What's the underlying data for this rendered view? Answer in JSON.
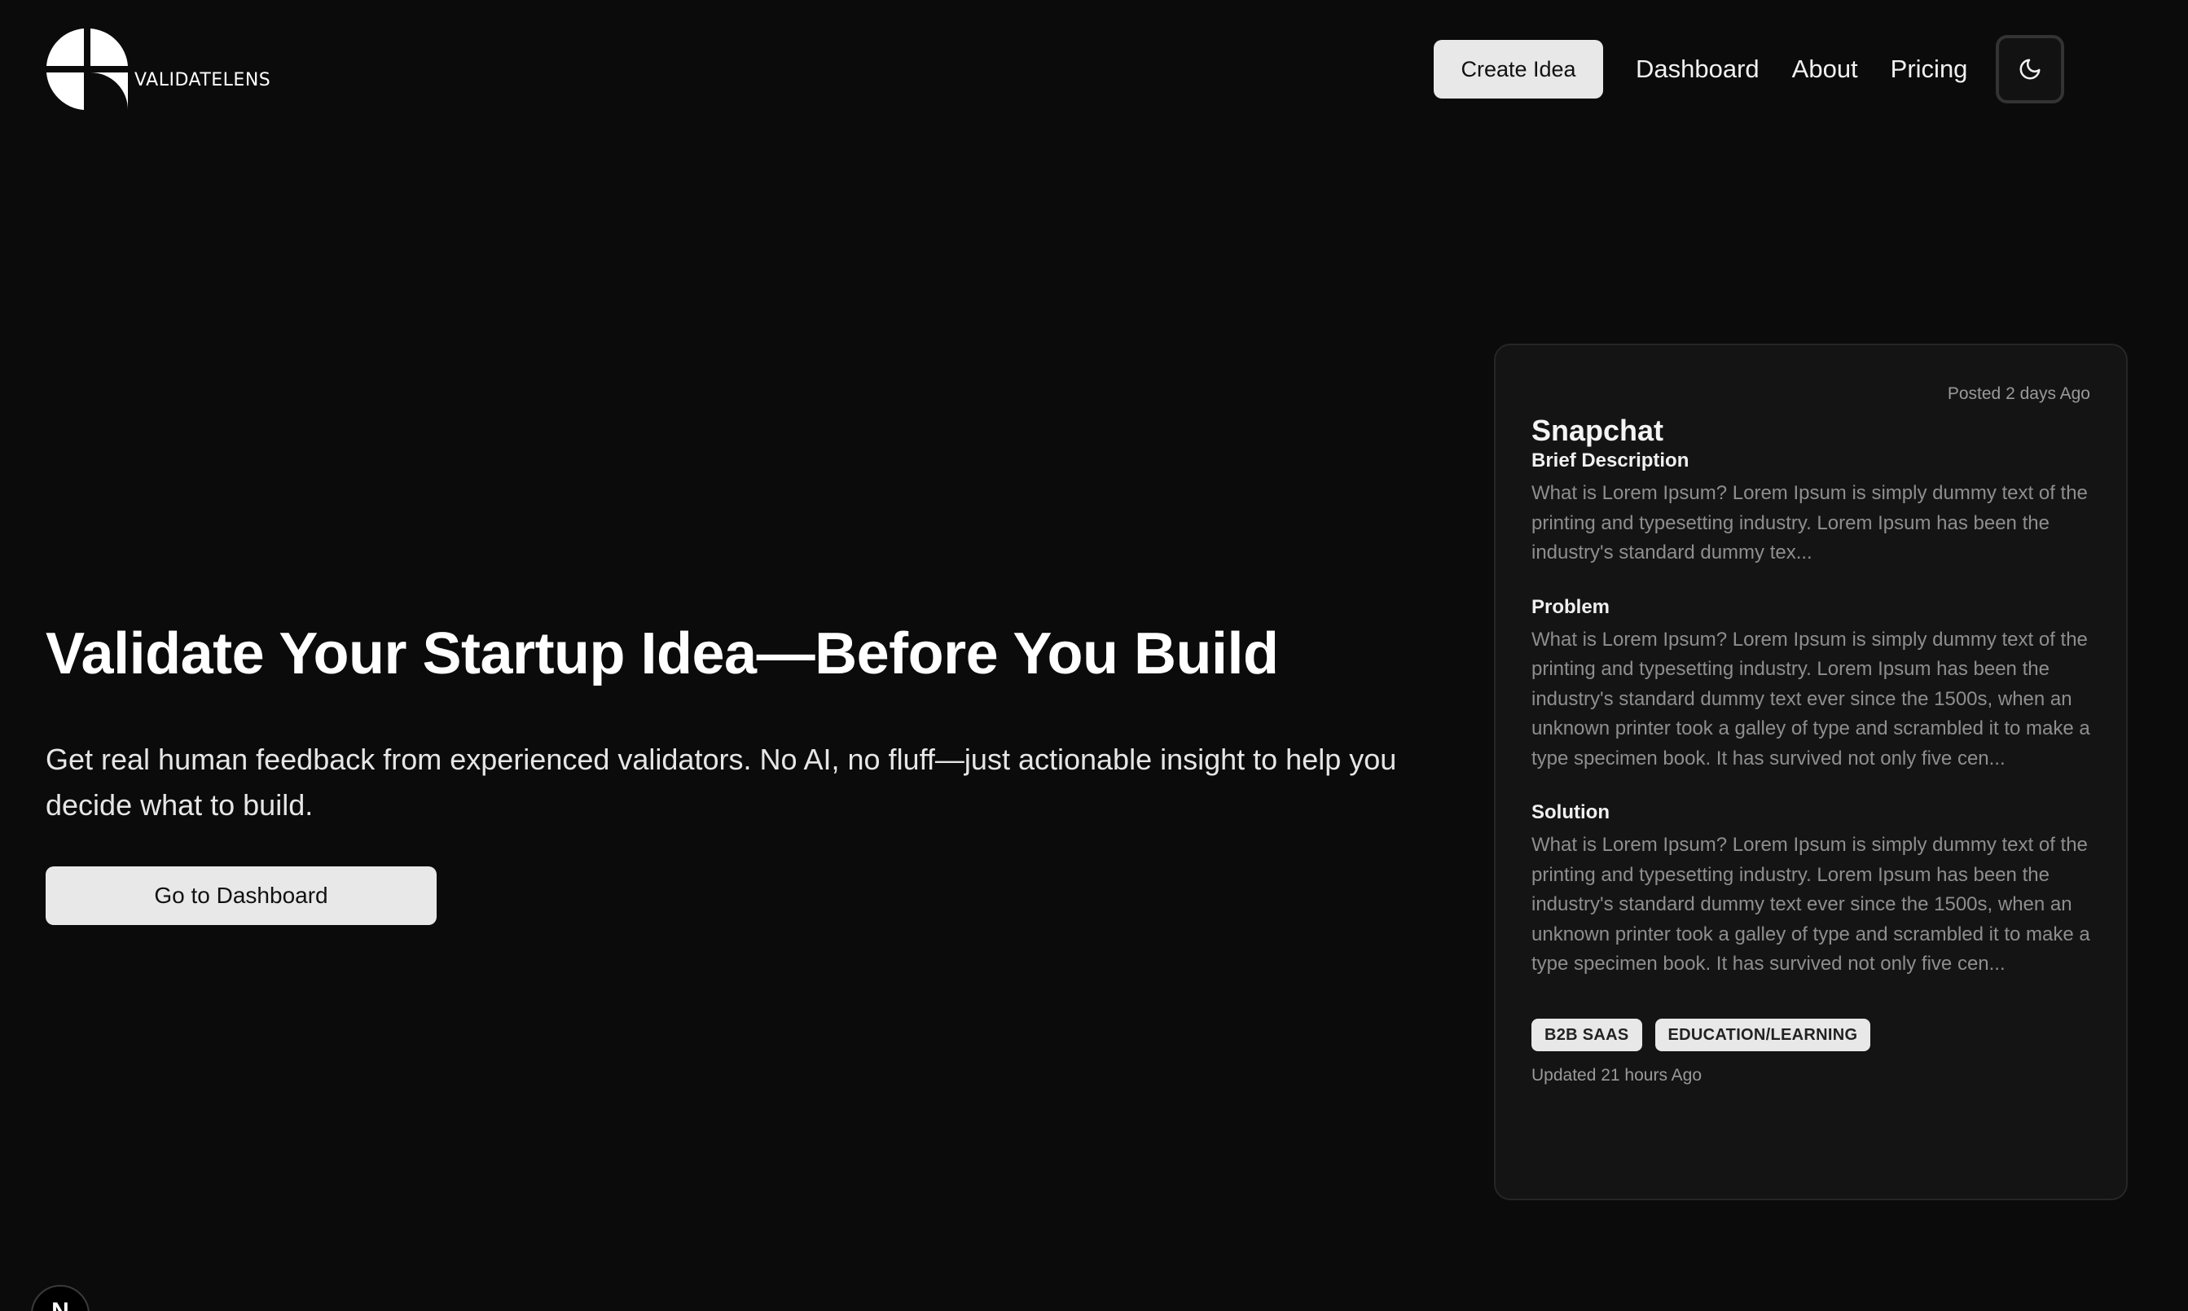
{
  "brand": {
    "name": "VALIDATELENS",
    "logo_icon": "quartered-circle-logo"
  },
  "nav": {
    "create_label": "Create Idea",
    "links": [
      "Dashboard",
      "About",
      "Pricing"
    ],
    "theme_icon": "moon-icon"
  },
  "hero": {
    "title": "Validate Your Startup Idea—Before You Build",
    "subtitle": "Get real human feedback from experienced validators. No AI, no fluff—just actionable insight to help you decide what to build.",
    "cta_label": "Go to Dashboard"
  },
  "card": {
    "posted": "Posted 2 days Ago",
    "title": "Snapchat",
    "brief_label": "Brief Description",
    "brief_text": "What is Lorem Ipsum? Lorem Ipsum is simply dummy text of the printing and typesetting industry. Lorem Ipsum has been the industry's standard dummy tex...",
    "problem_label": "Problem",
    "problem_text": "What is Lorem Ipsum? Lorem Ipsum is simply dummy text of the printing and typesetting industry. Lorem Ipsum has been the industry's standard dummy text ever since the 1500s, when an unknown printer took a galley of type and scrambled it to make a type specimen book. It has survived not only five cen...",
    "solution_label": "Solution",
    "solution_text": "What is Lorem Ipsum? Lorem Ipsum is simply dummy text of the printing and typesetting industry. Lorem Ipsum has been the industry's standard dummy text ever since the 1500s, when an unknown printer took a galley of type and scrambled it to make a type specimen book. It has survived not only five cen...",
    "tags": [
      "B2B SAAS",
      "EDUCATION/LEARNING"
    ],
    "updated": "Updated 21 hours Ago"
  },
  "corner_badge": "N"
}
